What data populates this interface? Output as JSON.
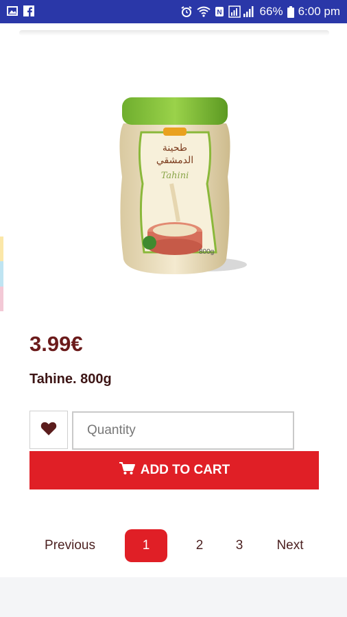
{
  "status_bar": {
    "battery": "66%",
    "time": "6:00 pm",
    "left_icons": [
      "image-icon",
      "facebook-icon"
    ],
    "right_icons": [
      "alarm-icon",
      "wifi-icon",
      "nfc-icon",
      "signal-icon",
      "battery-icon"
    ]
  },
  "product": {
    "image_alt": "Tahini",
    "price": "3.99€",
    "name": "Tahine. 800g"
  },
  "quantity": {
    "placeholder": "Quantity"
  },
  "actions": {
    "wishlist_icon": "heart-icon",
    "add_to_cart_label": "ADD TO CART",
    "cart_icon": "cart-icon"
  },
  "pagination": {
    "previous": "Previous",
    "pages": [
      "1",
      "2",
      "3"
    ],
    "current": "1",
    "next": "Next"
  },
  "colors": {
    "status_bar": "#2a37a8",
    "accent": "#e01f26",
    "price_text": "#6b1b1b"
  }
}
